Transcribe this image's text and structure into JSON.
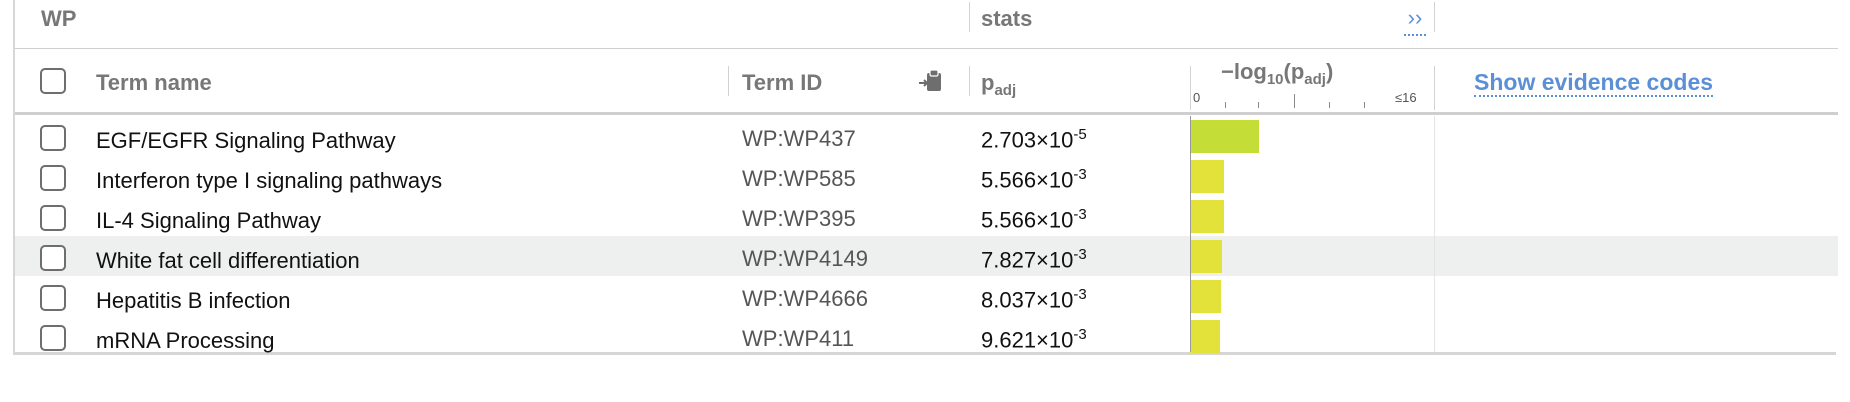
{
  "source": {
    "label": "WP"
  },
  "stats": {
    "label": "stats",
    "expand_glyph": "››"
  },
  "header": {
    "term_name": "Term name",
    "term_id": "Term ID",
    "padj_base": "p",
    "padj_sub": "adj",
    "log_prefix": "−log",
    "log_sub": "10",
    "log_open": "(p",
    "log_inner_sub": "adj",
    "log_close": ")",
    "axis_min": "0",
    "axis_max": "≤16",
    "show_evidence": "Show evidence codes"
  },
  "colors": {
    "bar_strong": "#c5dd37",
    "bar_weak": "#e2e23a",
    "link": "#5b8fd6"
  },
  "rows": [
    {
      "name": "EGF/EGFR Signaling Pathway",
      "id": "WP:WP437",
      "mantissa": "2.703×10",
      "exp": "-5",
      "neglog10": 4.568,
      "highlight": false
    },
    {
      "name": "Interferon type I signaling pathways",
      "id": "WP:WP585",
      "mantissa": "5.566×10",
      "exp": "-3",
      "neglog10": 2.254,
      "highlight": false
    },
    {
      "name": "IL-4 Signaling Pathway",
      "id": "WP:WP395",
      "mantissa": "5.566×10",
      "exp": "-3",
      "neglog10": 2.254,
      "highlight": false
    },
    {
      "name": "White fat cell differentiation",
      "id": "WP:WP4149",
      "mantissa": "7.827×10",
      "exp": "-3",
      "neglog10": 2.106,
      "highlight": true
    },
    {
      "name": "Hepatitis B infection",
      "id": "WP:WP4666",
      "mantissa": "8.037×10",
      "exp": "-3",
      "neglog10": 2.095,
      "highlight": false
    },
    {
      "name": "mRNA Processing",
      "id": "WP:WP411",
      "mantissa": "9.621×10",
      "exp": "-3",
      "neglog10": 2.017,
      "highlight": false
    }
  ]
}
